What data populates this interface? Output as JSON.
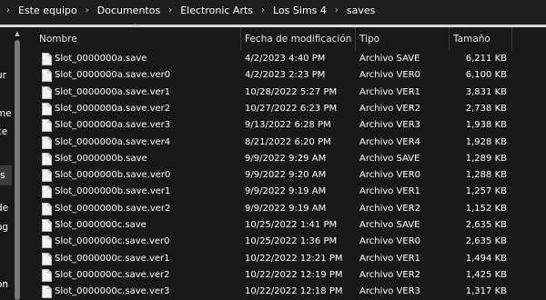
{
  "breadcrumb": [
    "Este equipo",
    "Documentos",
    "Electronic Arts",
    "Los Sims 4",
    "saves"
  ],
  "nav_fragments": [
    "ur",
    "me",
    "ce",
    "ts",
    "de",
    "og",
    "on"
  ],
  "columns": {
    "name": "Nombre",
    "date": "Fecha de modificación",
    "type": "Tipo",
    "size": "Tamaño"
  },
  "files": [
    {
      "name": "Slot_0000000a.save",
      "date": "4/2/2023 4:40 PM",
      "type": "Archivo SAVE",
      "size": "6,211 KB"
    },
    {
      "name": "Slot_0000000a.save.ver0",
      "date": "4/2/2023 2:23 PM",
      "type": "Archivo VER0",
      "size": "6,100 KB"
    },
    {
      "name": "Slot_0000000a.save.ver1",
      "date": "10/28/2022 5:27 PM",
      "type": "Archivo VER1",
      "size": "3,831 KB"
    },
    {
      "name": "Slot_0000000a.save.ver2",
      "date": "10/27/2022 6:23 PM",
      "type": "Archivo VER2",
      "size": "2,738 KB"
    },
    {
      "name": "Slot_0000000a.save.ver3",
      "date": "9/13/2022 6:28 PM",
      "type": "Archivo VER3",
      "size": "1,938 KB"
    },
    {
      "name": "Slot_0000000a.save.ver4",
      "date": "8/21/2022 6:20 PM",
      "type": "Archivo VER4",
      "size": "1,928 KB"
    },
    {
      "name": "Slot_0000000b.save",
      "date": "9/9/2022 9:29 AM",
      "type": "Archivo SAVE",
      "size": "1,289 KB"
    },
    {
      "name": "Slot_0000000b.save.ver0",
      "date": "9/9/2022 9:20 AM",
      "type": "Archivo VER0",
      "size": "1,288 KB"
    },
    {
      "name": "Slot_0000000b.save.ver1",
      "date": "9/9/2022 9:19 AM",
      "type": "Archivo VER1",
      "size": "1,257 KB"
    },
    {
      "name": "Slot_0000000b.save.ver2",
      "date": "9/9/2022 9:19 AM",
      "type": "Archivo VER2",
      "size": "1,152 KB"
    },
    {
      "name": "Slot_0000000c.save",
      "date": "10/25/2022 1:41 PM",
      "type": "Archivo SAVE",
      "size": "2,635 KB"
    },
    {
      "name": "Slot_0000000c.save.ver0",
      "date": "10/25/2022 1:36 PM",
      "type": "Archivo VER0",
      "size": "2,635 KB"
    },
    {
      "name": "Slot_0000000c.save.ver1",
      "date": "10/22/2022 12:21 PM",
      "type": "Archivo VER1",
      "size": "1,494 KB"
    },
    {
      "name": "Slot_0000000c.save.ver2",
      "date": "10/22/2022 12:19 PM",
      "type": "Archivo VER2",
      "size": "1,425 KB"
    },
    {
      "name": "Slot_0000000c.save.ver3",
      "date": "10/22/2022 12:18 PM",
      "type": "Archivo VER3",
      "size": "1,317 KB"
    }
  ]
}
